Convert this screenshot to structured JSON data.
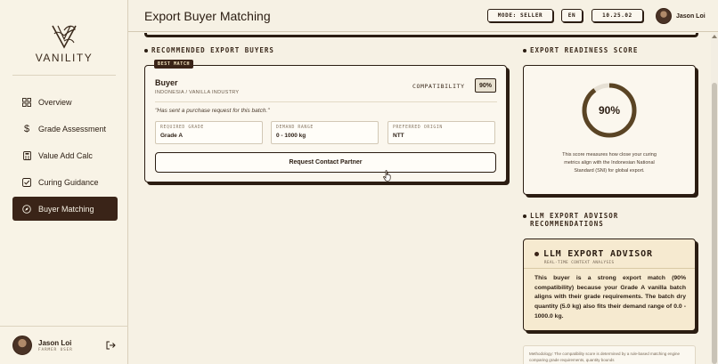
{
  "brand": {
    "name": "VANILITY"
  },
  "header": {
    "title": "Export Buyer Matching",
    "mode_chip": "MODE: SELLER",
    "lang_chip": "EN",
    "date_chip": "10.25.02",
    "user_name": "Jason Loi"
  },
  "sidebar": {
    "items": [
      {
        "label": "Overview",
        "icon": "grid-icon",
        "active": false
      },
      {
        "label": "Grade Assessment",
        "icon": "dollar-icon",
        "active": false
      },
      {
        "label": "Value Add Calc",
        "icon": "calculator-icon",
        "active": false
      },
      {
        "label": "Curing Guidance",
        "icon": "checkbox-icon",
        "active": false
      },
      {
        "label": "Buyer Matching",
        "icon": "compass-icon",
        "active": true
      }
    ],
    "user": {
      "name": "Jason Loi",
      "role": "FARMER USER"
    }
  },
  "recommended": {
    "section_title": "RECOMMENDED EXPORT BUYERS",
    "badge": "BEST MATCH",
    "buyer_name": "Buyer",
    "buyer_sub": "INDONESIA / VANILLA INDUSTRY",
    "compat_label": "COMPATIBILITY",
    "compat_value": "90%",
    "quote": "\"Has sent a purchase request for this batch.\"",
    "fields": [
      {
        "label": "REQUIRED GRADE",
        "value": "Grade A"
      },
      {
        "label": "DEMAND RANGE",
        "value": "0 - 1000 kg"
      },
      {
        "label": "PREFERRED ORIGIN",
        "value": "NTT"
      }
    ],
    "button_label": "Request Contact Partner"
  },
  "readiness": {
    "section_title": "EXPORT READINESS SCORE",
    "score_text": "90%",
    "score_fraction": 0.9,
    "description": "This score measures how close your curing metrics align with the Indonesian National Standard (SNI) for global export."
  },
  "advisor": {
    "section_title": "LLM EXPORT ADVISOR RECOMMENDATIONS",
    "card_title": "LLM EXPORT ADVISOR",
    "card_sub": "REAL-TIME CONTEXT ANALYSIS",
    "body": "This buyer is a strong export match (90% compatibility) because your Grade A vanilla batch aligns with their grade requirements. The batch dry quantity (5.0 kg) also fits their demand range of 0.0 - 1000.0 kg.",
    "methodology": "Methodology: The compatibility score is determined by a rule-based matching engine comparing grade requirements, quantity bounds"
  },
  "colors": {
    "primary": "#3a2418",
    "background": "#f6f1e4",
    "ring_track": "#e6e0d4",
    "ring_fill": "#5a4424"
  }
}
